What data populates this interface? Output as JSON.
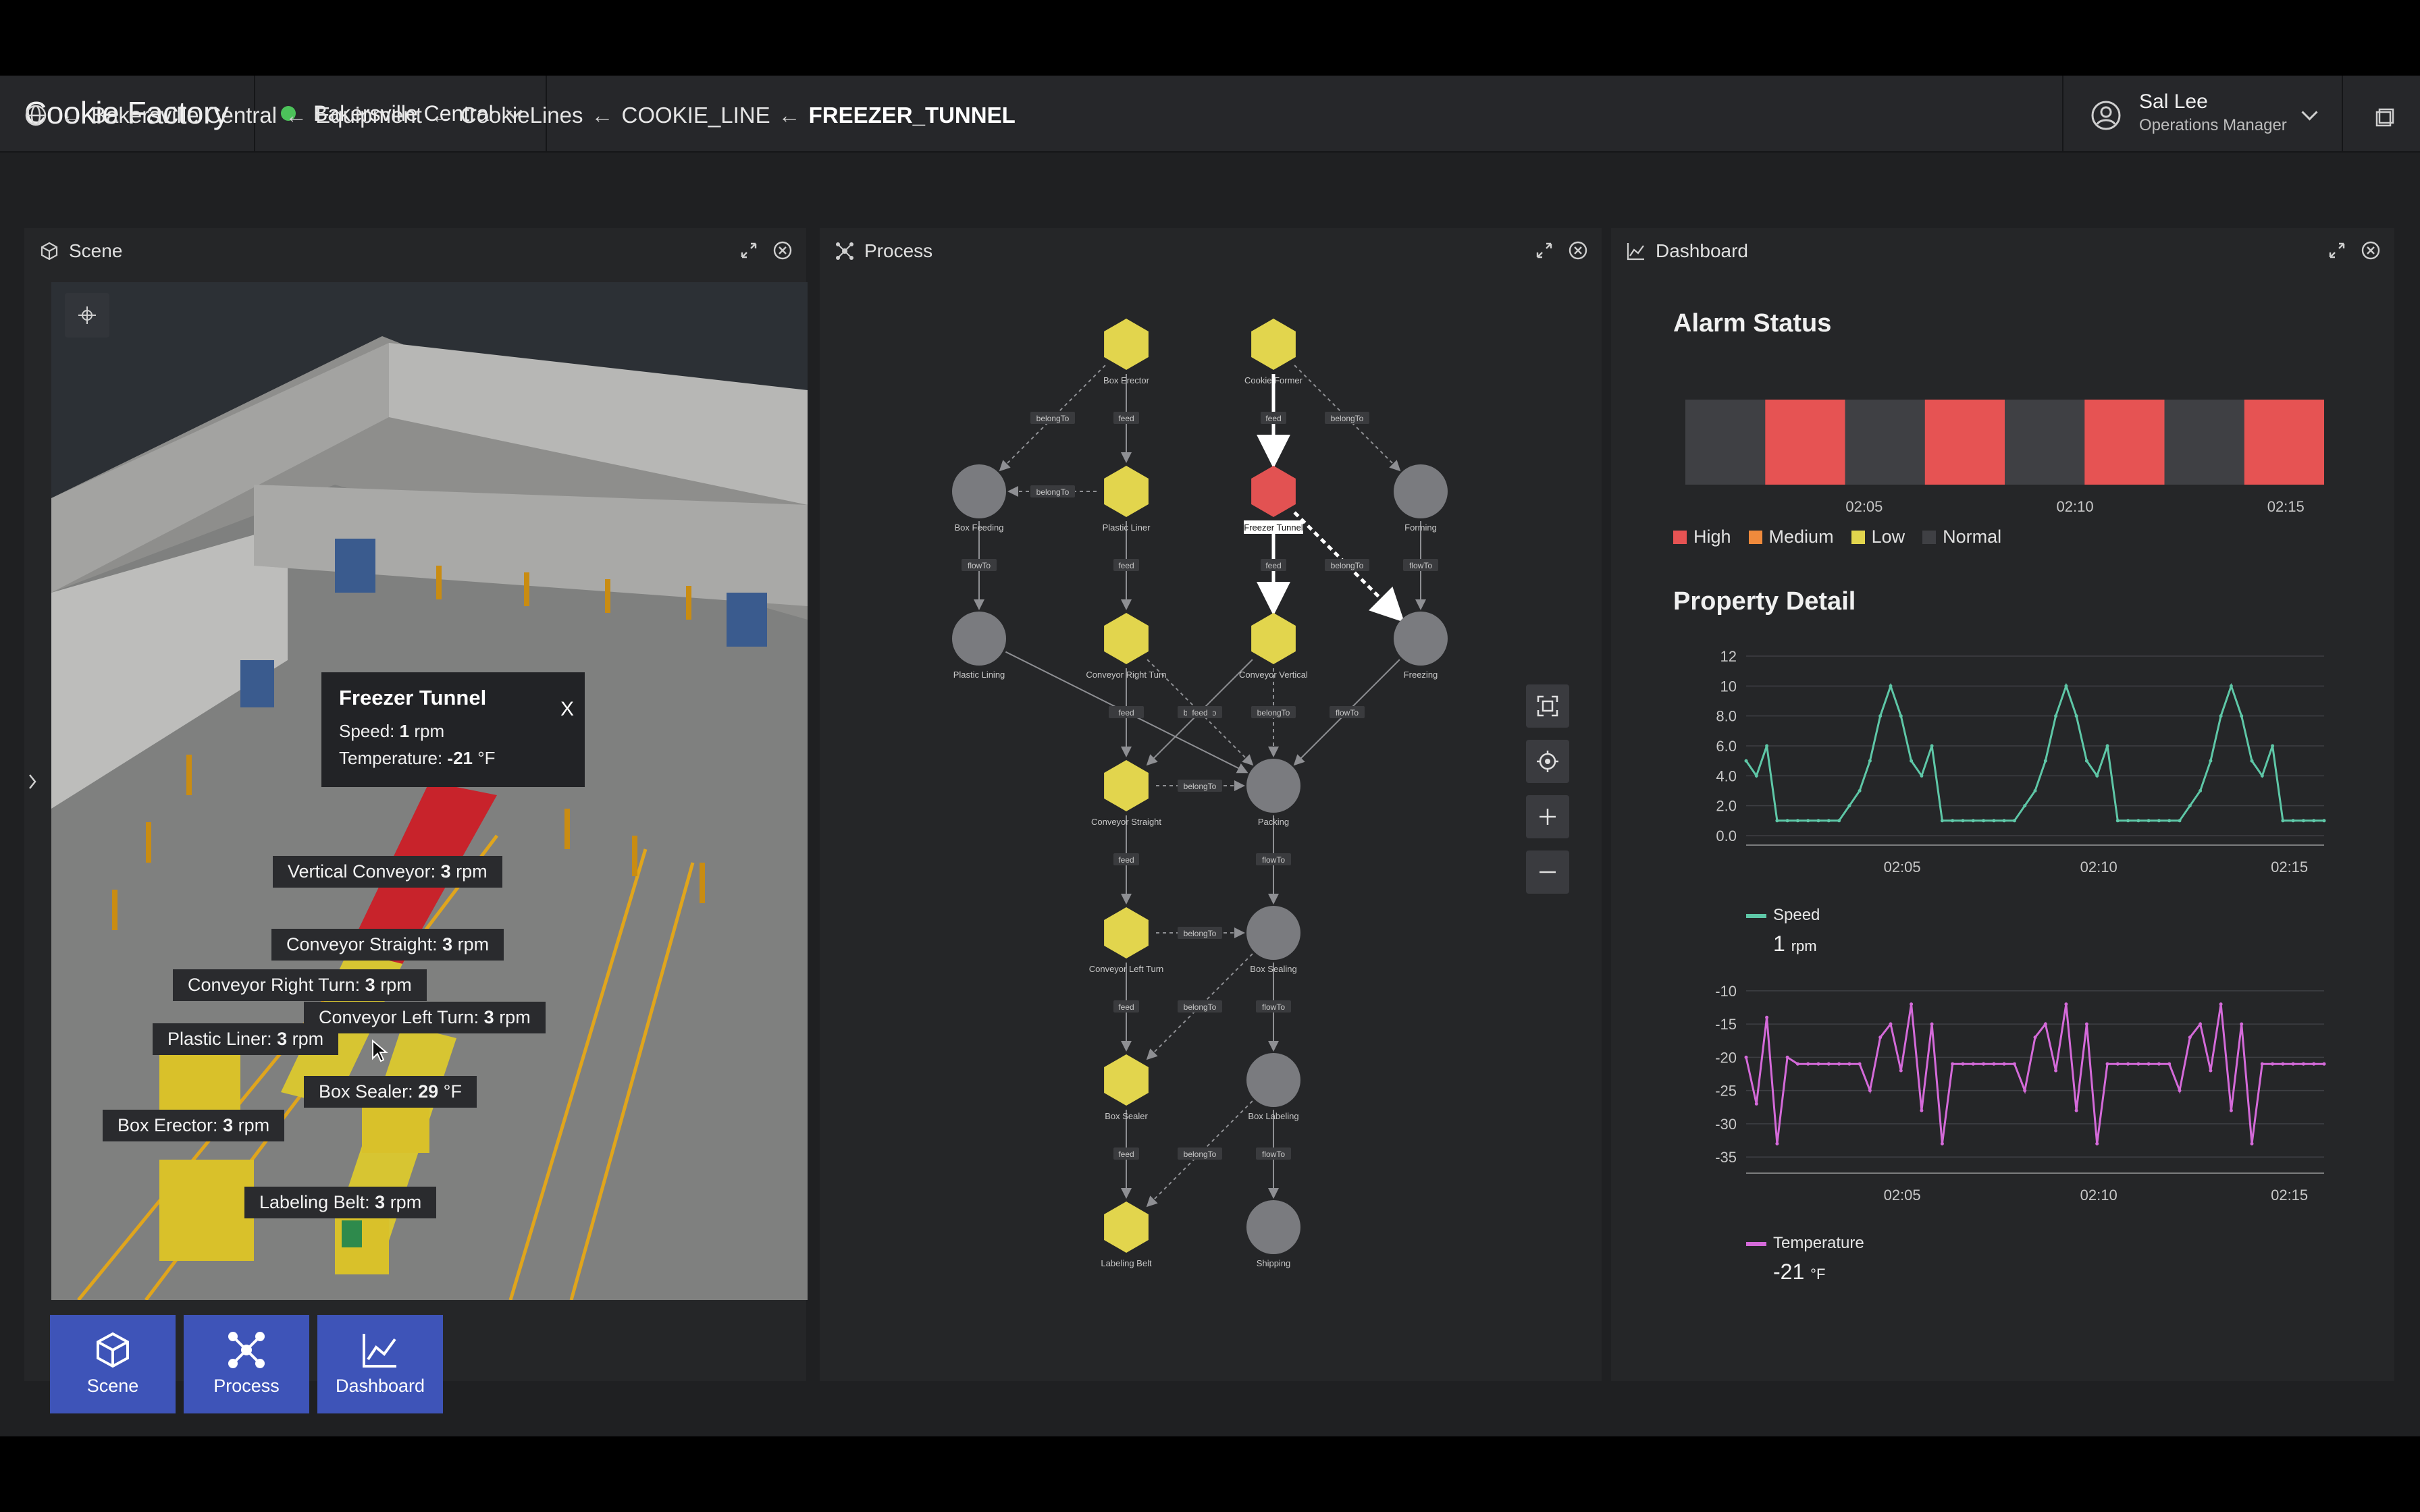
{
  "brand": "Cookie Factory",
  "site": {
    "label": "Bakersville Central",
    "status_color": "#4cc25a"
  },
  "user": {
    "name": "Sal Lee",
    "role": "Operations Manager"
  },
  "breadcrumb": {
    "items": [
      "Bakersville Central",
      "Equipment",
      "CookieLines",
      "COOKIE_LINE"
    ],
    "current": "FREEZER_TUNNEL",
    "separator": "←"
  },
  "panels": {
    "scene": "Scene",
    "process": "Process",
    "dashboard": "Dashboard"
  },
  "scene": {
    "popup": {
      "title": "Freezer Tunnel",
      "speed_label": "Speed:",
      "speed_value": "1",
      "speed_unit": "rpm",
      "temp_label": "Temperature:",
      "temp_value": "-21",
      "temp_unit": "°F",
      "close": "X"
    },
    "tags": [
      {
        "label": "Vertical Conveyor:",
        "value": "3",
        "unit": "rpm"
      },
      {
        "label": "Conveyor Straight:",
        "value": "3",
        "unit": "rpm"
      },
      {
        "label": "Conveyor Right Turn:",
        "value": "3",
        "unit": "rpm"
      },
      {
        "label": "Conveyor Left Turn:",
        "value": "3",
        "unit": "rpm"
      },
      {
        "label": "Plastic Liner:",
        "value": "3",
        "unit": "rpm"
      },
      {
        "label": "Box Sealer:",
        "value": "29",
        "unit": "°F"
      },
      {
        "label": "Box Erector:",
        "value": "3",
        "unit": "rpm"
      },
      {
        "label": "Labeling Belt:",
        "value": "3",
        "unit": "rpm"
      }
    ]
  },
  "process": {
    "nodes": [
      {
        "id": "box-erector",
        "label": "Box Erector",
        "shape": "hex",
        "state": "low"
      },
      {
        "id": "cookie-former",
        "label": "Cookie Former",
        "shape": "hex",
        "state": "low"
      },
      {
        "id": "box-feeding",
        "label": "Box Feeding",
        "shape": "circle",
        "state": "normal"
      },
      {
        "id": "plastic-liner",
        "label": "Plastic Liner",
        "shape": "hex",
        "state": "low"
      },
      {
        "id": "freezer-tunnel",
        "label": "Freezer Tunnel",
        "shape": "hex",
        "state": "high"
      },
      {
        "id": "forming",
        "label": "Forming",
        "shape": "circle",
        "state": "normal"
      },
      {
        "id": "plastic-lining",
        "label": "Plastic Lining",
        "shape": "circle",
        "state": "normal"
      },
      {
        "id": "conveyor-right-turn",
        "label": "Conveyor Right Turn",
        "shape": "hex",
        "state": "low"
      },
      {
        "id": "conveyor-vertical",
        "label": "Conveyor Vertical",
        "shape": "hex",
        "state": "low"
      },
      {
        "id": "freezing",
        "label": "Freezing",
        "shape": "circle",
        "state": "normal"
      },
      {
        "id": "conveyor-straight",
        "label": "Conveyor Straight",
        "shape": "hex",
        "state": "low"
      },
      {
        "id": "packing",
        "label": "Packing",
        "shape": "circle",
        "state": "normal"
      },
      {
        "id": "conveyor-left-turn",
        "label": "Conveyor Left Turn",
        "shape": "hex",
        "state": "low"
      },
      {
        "id": "box-sealing",
        "label": "Box Sealing",
        "shape": "circle",
        "state": "normal"
      },
      {
        "id": "box-sealer",
        "label": "Box Sealer",
        "shape": "hex",
        "state": "low"
      },
      {
        "id": "box-labeling",
        "label": "Box Labeling",
        "shape": "circle",
        "state": "normal"
      },
      {
        "id": "labeling-belt",
        "label": "Labeling Belt",
        "shape": "hex",
        "state": "low"
      },
      {
        "id": "shipping",
        "label": "Shipping",
        "shape": "circle",
        "state": "normal"
      }
    ],
    "edges": [
      {
        "from": "box-erector",
        "to": "box-feeding",
        "label": "belongTo"
      },
      {
        "from": "box-erector",
        "to": "plastic-liner",
        "label": "feed"
      },
      {
        "from": "cookie-former",
        "to": "freezer-tunnel",
        "label": "feed",
        "highlight": true
      },
      {
        "from": "cookie-former",
        "to": "forming",
        "label": "belongTo"
      },
      {
        "from": "box-feeding",
        "to": "plastic-lining",
        "label": "flowTo"
      },
      {
        "from": "plastic-liner",
        "to": "box-feeding",
        "label": "belongTo"
      },
      {
        "from": "plastic-liner",
        "to": "conveyor-right-turn",
        "label": "feed"
      },
      {
        "from": "freezer-tunnel",
        "to": "conveyor-vertical",
        "label": "feed",
        "highlight": true
      },
      {
        "from": "freezer-tunnel",
        "to": "freezing",
        "label": "belongTo",
        "highlight": true
      },
      {
        "from": "forming",
        "to": "freezing",
        "label": "flowTo"
      },
      {
        "from": "plastic-lining",
        "to": "packing",
        "label": "flowTo"
      },
      {
        "from": "conveyor-right-turn",
        "to": "conveyor-straight",
        "label": "feed"
      },
      {
        "from": "conveyor-right-turn",
        "to": "packing",
        "label": "belongTo"
      },
      {
        "from": "conveyor-vertical",
        "to": "conveyor-straight",
        "label": "feed"
      },
      {
        "from": "conveyor-vertical",
        "to": "packing",
        "label": "belongTo"
      },
      {
        "from": "freezing",
        "to": "packing",
        "label": "flowTo"
      },
      {
        "from": "conveyor-straight",
        "to": "packing",
        "label": "belongTo"
      },
      {
        "from": "conveyor-straight",
        "to": "conveyor-left-turn",
        "label": "feed"
      },
      {
        "from": "packing",
        "to": "box-sealing",
        "label": "flowTo"
      },
      {
        "from": "conveyor-left-turn",
        "to": "box-sealing",
        "label": "belongTo"
      },
      {
        "from": "conveyor-left-turn",
        "to": "box-sealer",
        "label": "feed"
      },
      {
        "from": "box-sealing",
        "to": "box-sealer",
        "label": "belongTo"
      },
      {
        "from": "box-sealing",
        "to": "box-labeling",
        "label": "flowTo"
      },
      {
        "from": "box-sealer",
        "to": "labeling-belt",
        "label": "feed"
      },
      {
        "from": "box-labeling",
        "to": "labeling-belt",
        "label": "belongTo"
      },
      {
        "from": "box-labeling",
        "to": "shipping",
        "label": "flowTo"
      }
    ],
    "colors": {
      "low": "#e2d54d",
      "high": "#e25252",
      "normal": "#7a7b7f",
      "edge": "#8e8f93",
      "highlight": "#ffffff"
    }
  },
  "dashboard": {
    "alarm_title": "Alarm Status",
    "property_title": "Property Detail",
    "legend": [
      {
        "label": "High",
        "color": "#e65353"
      },
      {
        "label": "Medium",
        "color": "#f08a3c"
      },
      {
        "label": "Low",
        "color": "#e2d54d"
      },
      {
        "label": "Normal",
        "color": "#3f4044"
      }
    ],
    "speed_metric": {
      "name": "Speed",
      "value": "1",
      "unit": "rpm",
      "color": "#5ec7a7"
    },
    "temp_metric": {
      "name": "Temperature",
      "value": "-21",
      "unit": "°F",
      "color": "#d46ad9"
    }
  },
  "nav": [
    {
      "id": "scene",
      "label": "Scene"
    },
    {
      "id": "process",
      "label": "Process"
    },
    {
      "id": "dashboard",
      "label": "Dashboard"
    }
  ],
  "chart_data": [
    {
      "type": "timeline",
      "title": "Alarm Status",
      "x_ticks": [
        "02:05",
        "02:10",
        "02:15"
      ],
      "x": [
        0,
        1,
        2,
        3,
        4,
        5,
        6,
        7
      ],
      "states": [
        "normal",
        "high",
        "normal",
        "high",
        "normal",
        "high",
        "normal",
        "high"
      ],
      "legend": [
        "High",
        "Medium",
        "Low",
        "Normal"
      ]
    },
    {
      "type": "line",
      "series": [
        {
          "name": "Speed",
          "values": [
            5,
            4,
            6,
            1,
            1,
            1,
            1,
            1,
            1,
            1,
            2,
            3,
            5,
            8,
            10,
            8,
            5,
            4,
            6,
            1,
            1,
            1,
            1,
            1,
            1,
            1,
            1,
            2,
            3,
            5,
            8,
            10,
            8,
            5,
            4,
            6,
            1,
            1,
            1,
            1,
            1,
            1,
            1,
            2,
            3,
            5,
            8,
            10,
            8,
            5,
            4,
            6,
            1,
            1,
            1,
            1,
            1
          ]
        }
      ],
      "y_ticks": [
        "0.0",
        "2.0",
        "4.0",
        "6.0",
        "8.0",
        "10",
        "12"
      ],
      "x_ticks": [
        "02:05",
        "02:10",
        "02:15"
      ],
      "ylim": [
        0,
        12
      ]
    },
    {
      "type": "line",
      "series": [
        {
          "name": "Temperature",
          "values": [
            -20,
            -27,
            -14,
            -33,
            -20,
            -21,
            -21,
            -21,
            -21,
            -21,
            -21,
            -21,
            -25,
            -17,
            -15,
            -22,
            -12,
            -28,
            -15,
            -33,
            -21,
            -21,
            -21,
            -21,
            -21,
            -21,
            -21,
            -25,
            -17,
            -15,
            -22,
            -12,
            -28,
            -15,
            -33,
            -21,
            -21,
            -21,
            -21,
            -21,
            -21,
            -21,
            -25,
            -17,
            -15,
            -22,
            -12,
            -28,
            -15,
            -33,
            -21,
            -21,
            -21,
            -21,
            -21,
            -21,
            -21
          ]
        }
      ],
      "y_ticks": [
        "-10",
        "-15",
        "-20",
        "-25",
        "-30",
        "-35"
      ],
      "x_ticks": [
        "02:05",
        "02:10",
        "02:15"
      ],
      "ylim": [
        -36,
        -9
      ]
    }
  ]
}
